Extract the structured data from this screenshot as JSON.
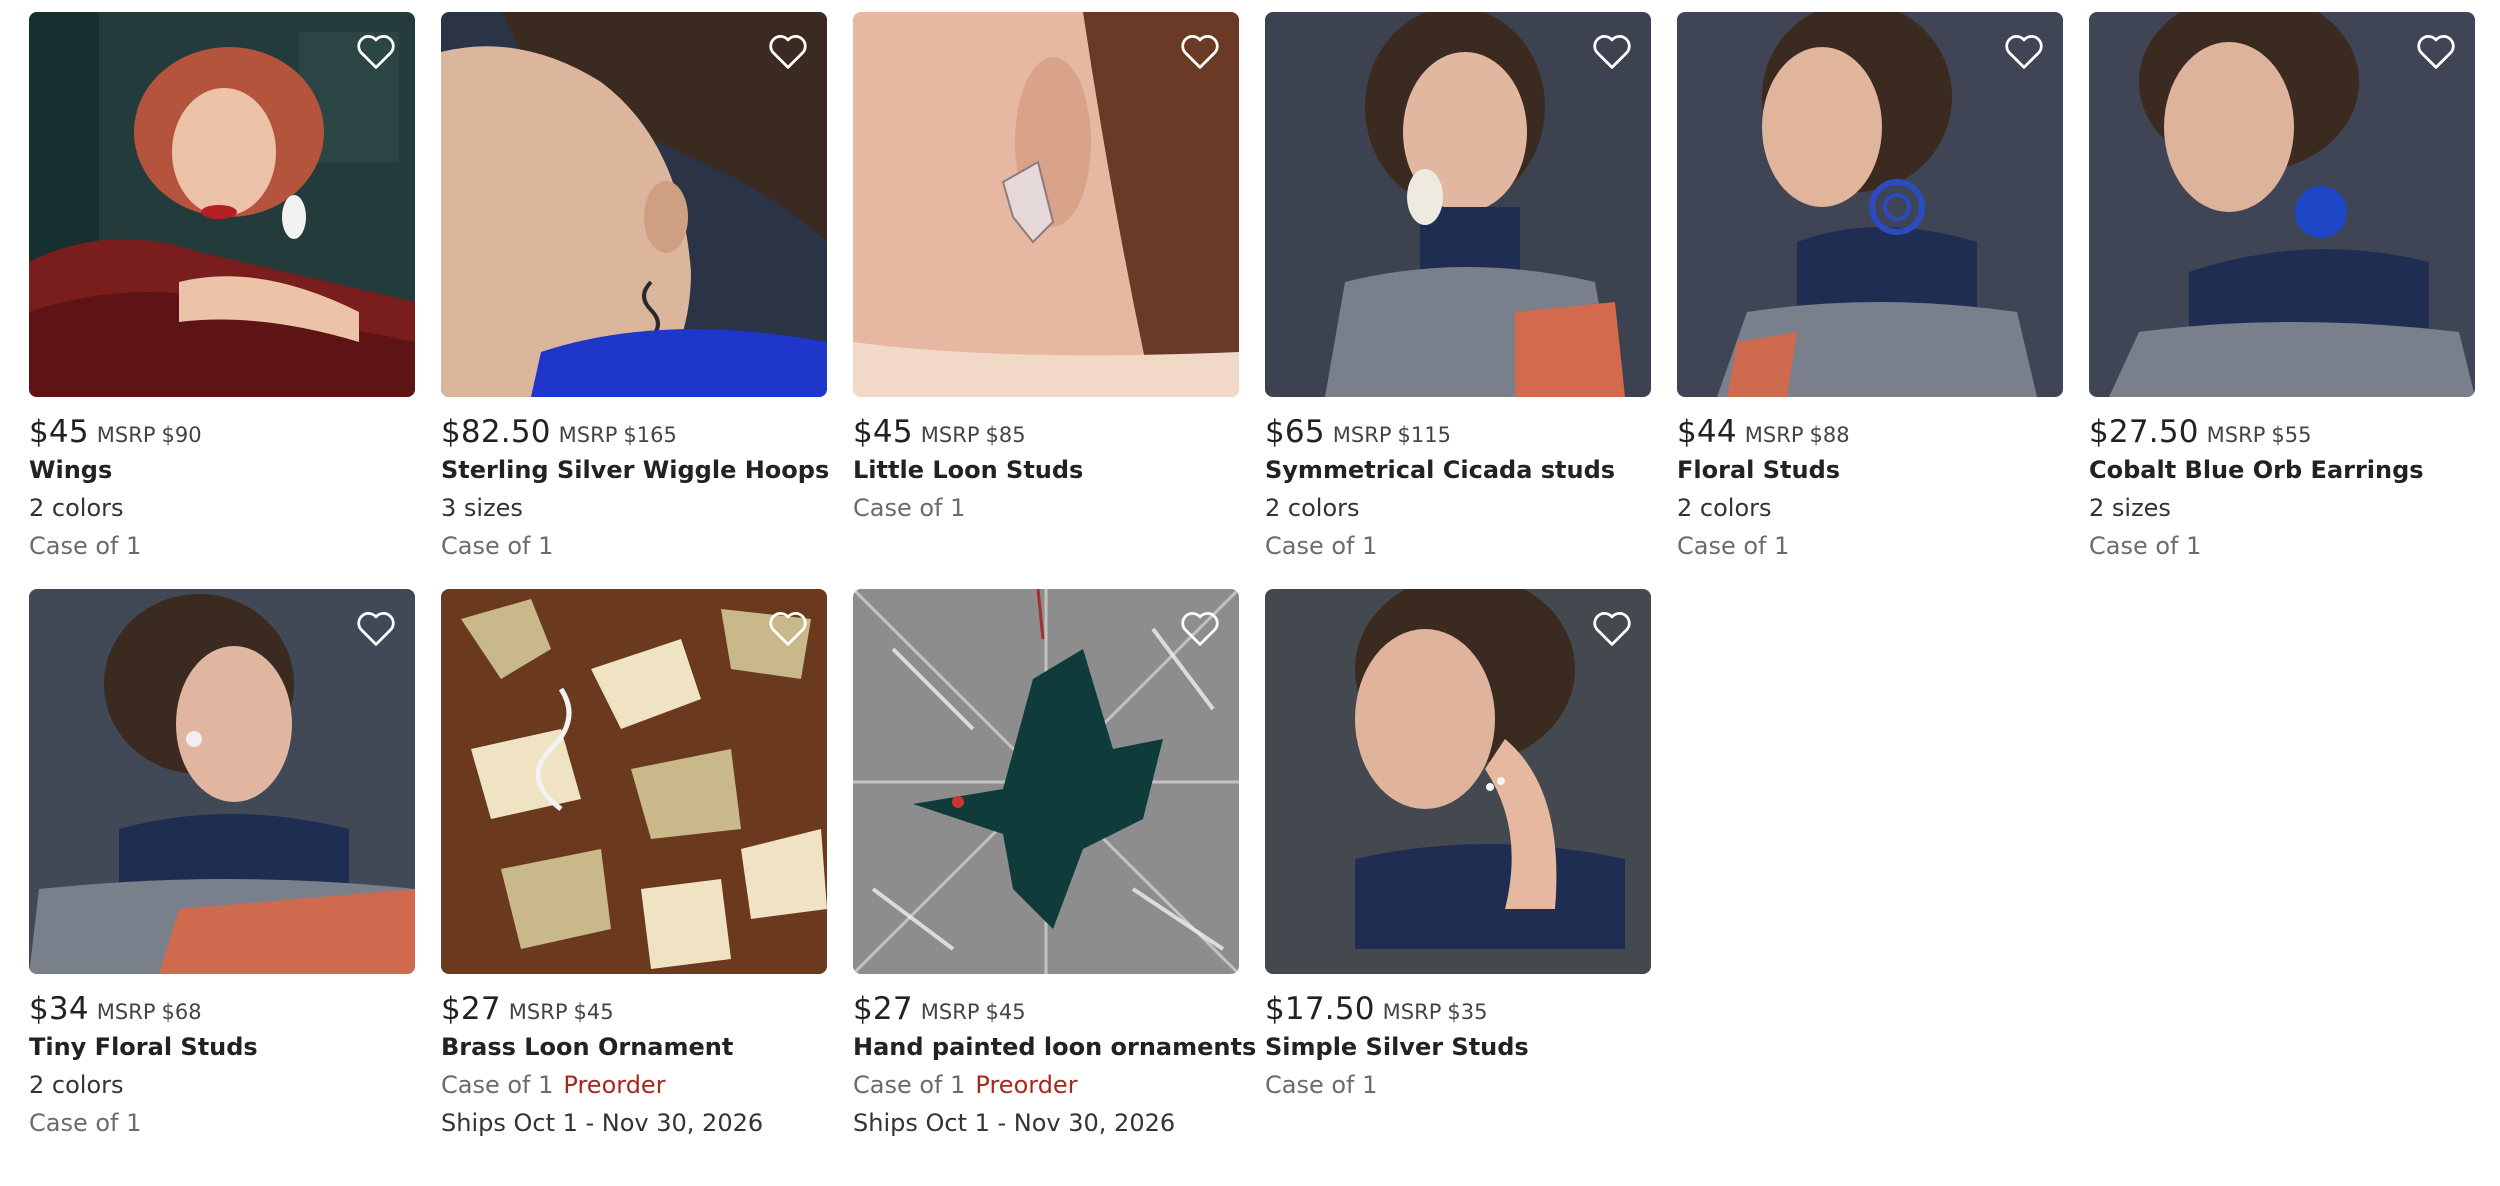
{
  "products": [
    {
      "price": "$45",
      "msrp_label": "MSRP",
      "msrp": "$90",
      "name": "Wings",
      "variants": "2 colors",
      "case": "Case of 1",
      "image": {
        "subject": "woman-with-curly-red-hair-wearing-white-wing-earring",
        "palette": [
          "#1f3a3a",
          "#7a1d1d",
          "#b5543c"
        ]
      },
      "favorite_icon": "heart-outline-icon"
    },
    {
      "price": "$82.50",
      "msrp_label": "MSRP",
      "msrp": "$165",
      "name": "Sterling Silver Wiggle Hoops",
      "variants": "3 sizes",
      "case": "Case of 1",
      "image": {
        "subject": "woman-profile-with-wiggle-hoop-earring-blue-collar",
        "palette": [
          "#2b3447",
          "#d9b7a0",
          "#1e36c9"
        ]
      },
      "favorite_icon": "heart-outline-icon"
    },
    {
      "price": "$45",
      "msrp_label": "MSRP",
      "msrp": "$85",
      "name": "Little Loon Studs",
      "case": "Case of 1",
      "image": {
        "subject": "ear-close-up-with-loon-stud",
        "palette": [
          "#e2b49f",
          "#6a3a26",
          "#f1d8c7"
        ]
      },
      "favorite_icon": "heart-outline-icon"
    },
    {
      "price": "$65",
      "msrp_label": "MSRP",
      "msrp": "$115",
      "name": "Symmetrical Cicada studs",
      "variants": "2 colors",
      "case": "Case of 1",
      "image": {
        "subject": "woman-smiling-with-cicada-stud-navy-turtleneck",
        "palette": [
          "#3c4250",
          "#1f2d52",
          "#d36a4e"
        ]
      },
      "favorite_icon": "heart-outline-icon"
    },
    {
      "price": "$44",
      "msrp_label": "MSRP",
      "msrp": "$88",
      "name": "Floral Studs",
      "variants": "2 colors",
      "case": "Case of 1",
      "image": {
        "subject": "woman-with-blue-floral-stud-navy-turtleneck",
        "palette": [
          "#3f4554",
          "#1f2d52",
          "#2b4cc0"
        ]
      },
      "favorite_icon": "heart-outline-icon"
    },
    {
      "price": "$27.50",
      "msrp_label": "MSRP",
      "msrp": "$55",
      "name": "Cobalt Blue Orb Earrings",
      "variants": "2 sizes",
      "case": "Case of 1",
      "image": {
        "subject": "woman-with-cobalt-orb-earring-navy-turtleneck",
        "palette": [
          "#3f4554",
          "#1f2d52",
          "#1d47c7"
        ]
      },
      "favorite_icon": "heart-outline-icon"
    },
    {
      "price": "$34",
      "msrp_label": "MSRP",
      "msrp": "$68",
      "name": "Tiny Floral Studs",
      "variants": "2 colors",
      "case": "Case of 1",
      "image": {
        "subject": "woman-with-tiny-floral-stud-striped-sweater",
        "palette": [
          "#414856",
          "#1f2d52",
          "#cf6a4f"
        ]
      },
      "favorite_icon": "heart-outline-icon"
    },
    {
      "price": "$27",
      "msrp_label": "MSRP",
      "msrp": "$45",
      "name": "Brass Loon Ornament",
      "case": "Case of 1",
      "status": "Preorder",
      "ships": "Ships Oct 1 - Nov 30, 2026",
      "image": {
        "subject": "brass-loon-ornaments-on-rust-background",
        "palette": [
          "#6b3a1e",
          "#c9b98a",
          "#efe3c4"
        ]
      },
      "favorite_icon": "heart-outline-icon"
    },
    {
      "price": "$27",
      "msrp_label": "MSRP",
      "msrp": "$45",
      "name": "Hand painted loon ornaments",
      "case": "Case of 1",
      "status": "Preorder",
      "ships": "Ships Oct 1 - Nov 30, 2026",
      "image": {
        "subject": "painted-loon-ornament-on-silver-tinsel",
        "palette": [
          "#8d8d8d",
          "#0f3b3b",
          "#d9d9d9"
        ]
      },
      "favorite_icon": "heart-outline-icon"
    },
    {
      "price": "$17.50",
      "msrp_label": "MSRP",
      "msrp": "$35",
      "name": "Simple Silver Studs",
      "case": "Case of 1",
      "image": {
        "subject": "woman-touching-ear-with-silver-studs",
        "palette": [
          "#44494f",
          "#1f2d52",
          "#e0b49c"
        ]
      },
      "favorite_icon": "heart-outline-icon"
    }
  ],
  "colors": {
    "preorder": "#a8271c",
    "text": "#222222",
    "muted": "#6b6b6b"
  }
}
